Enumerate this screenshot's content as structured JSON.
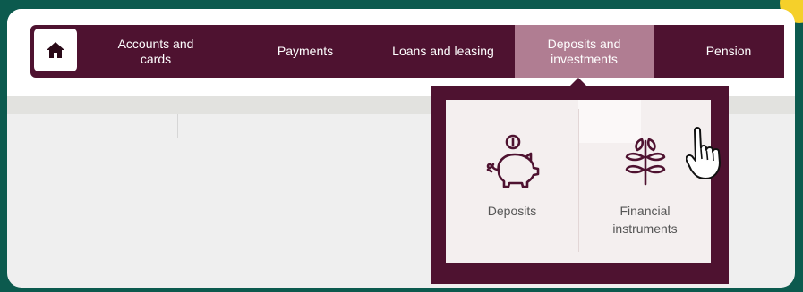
{
  "nav": {
    "items": [
      {
        "line1": "Accounts and",
        "line2": "cards"
      },
      {
        "line1": "Payments",
        "line2": ""
      },
      {
        "line1": "Loans and leasing",
        "line2": ""
      },
      {
        "line1": "Deposits and",
        "line2": "investments"
      },
      {
        "line1": "Pension",
        "line2": ""
      }
    ],
    "active_index": 3
  },
  "dropdown": {
    "items": [
      {
        "label": "Deposits",
        "icon": "piggy-bank-icon"
      },
      {
        "label1": "Financial",
        "label2": "instruments",
        "icon": "plant-icon"
      }
    ]
  },
  "colors": {
    "brand": "#4e1230",
    "active_tab": "#b07d92",
    "background": "#0c5a4e",
    "accent": "#f5d02a"
  },
  "icons": [
    "home-icon",
    "piggy-bank-icon",
    "plant-icon",
    "hand-pointer-icon"
  ]
}
